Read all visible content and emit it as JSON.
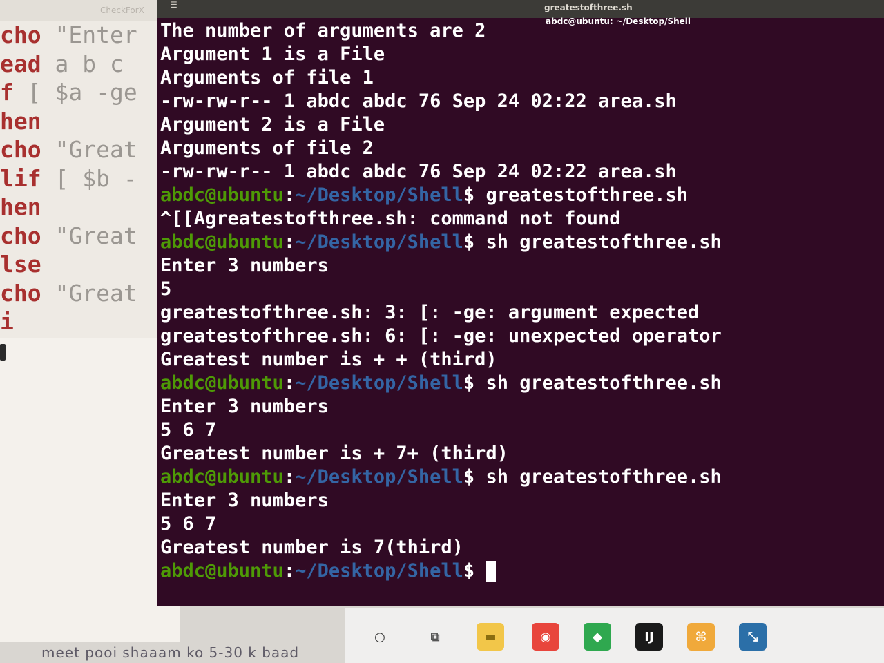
{
  "editor": {
    "tab_title": "CheckForX",
    "lines": [
      {
        "kw": "cho",
        "rest": " \"Enter"
      },
      {
        "kw": "ead",
        "rest": " a b c"
      },
      {
        "kw": "f",
        "rest": " [ $a -ge"
      },
      {
        "kw": "hen",
        "rest": ""
      },
      {
        "kw": "cho",
        "rest": " \"Great"
      },
      {
        "kw": "lif",
        "rest": " [ $b -"
      },
      {
        "kw": "hen",
        "rest": ""
      },
      {
        "kw": "cho",
        "rest": " \"Great"
      },
      {
        "kw": "lse",
        "rest": ""
      },
      {
        "kw": "cho",
        "rest": " \"Great"
      },
      {
        "kw": "i",
        "rest": ""
      }
    ]
  },
  "terminal": {
    "window_title": "greatestofthree.sh",
    "header_path": "abdc@ubuntu: ~/Desktop/Shell",
    "prompt_user": "abdc@ubuntu",
    "prompt_sep": ":",
    "prompt_path": "~/Desktop/Shell",
    "prompt_dollar": "$",
    "lines": [
      {
        "type": "out",
        "text": "The number of arguments are 2"
      },
      {
        "type": "out",
        "text": "Argument 1 is a File"
      },
      {
        "type": "out",
        "text": "Arguments of file 1"
      },
      {
        "type": "out",
        "text": "-rw-rw-r-- 1 abdc abdc 76 Sep 24 02:22 area.sh"
      },
      {
        "type": "out",
        "text": "Argument 2 is a File"
      },
      {
        "type": "out",
        "text": "Arguments of file 2"
      },
      {
        "type": "out",
        "text": "-rw-rw-r-- 1 abdc abdc 76 Sep 24 02:22 area.sh"
      },
      {
        "type": "prompt",
        "cmd": " greatestofthree.sh"
      },
      {
        "type": "out",
        "text": "^[[Agreatestofthree.sh: command not found"
      },
      {
        "type": "prompt",
        "cmd": " sh greatestofthree.sh"
      },
      {
        "type": "out",
        "text": "Enter 3 numbers"
      },
      {
        "type": "out",
        "text": "5"
      },
      {
        "type": "out",
        "text": "greatestofthree.sh: 3: [: -ge: argument expected"
      },
      {
        "type": "out",
        "text": "greatestofthree.sh: 6: [: -ge: unexpected operator"
      },
      {
        "type": "out",
        "text": "Greatest number is + + (third)"
      },
      {
        "type": "prompt",
        "cmd": " sh greatestofthree.sh"
      },
      {
        "type": "out",
        "text": "Enter 3 numbers"
      },
      {
        "type": "out",
        "text": "5 6 7"
      },
      {
        "type": "out",
        "text": "Greatest number is + 7+ (third)"
      },
      {
        "type": "prompt",
        "cmd": " sh greatestofthree.sh"
      },
      {
        "type": "out",
        "text": "Enter 3 numbers"
      },
      {
        "type": "out",
        "text": "5 6 7"
      },
      {
        "type": "out",
        "text": "Greatest number is 7(third)"
      },
      {
        "type": "prompt",
        "cmd": " ",
        "cursor": true
      }
    ]
  },
  "bottom_text": "meet pooi shaaam ko 5-30 k baad",
  "taskbar": {
    "icons": [
      {
        "name": "search-icon",
        "glyph": "○",
        "color": "#f0efee",
        "fg": "#333333"
      },
      {
        "name": "task-view-icon",
        "glyph": "⧉",
        "color": "#f0efee",
        "fg": "#555555"
      },
      {
        "name": "file-explorer-icon",
        "glyph": "▬",
        "color": "#f2c649",
        "fg": "#8a6d10"
      },
      {
        "name": "chrome-icon",
        "glyph": "◉",
        "color": "#e8453c",
        "fg": "#ffffff"
      },
      {
        "name": "maps-icon",
        "glyph": "◆",
        "color": "#2fa84f",
        "fg": "#ffffff"
      },
      {
        "name": "intellij-icon",
        "glyph": "IJ",
        "color": "#1a1a1a",
        "fg": "#ffffff"
      },
      {
        "name": "flow-app-icon",
        "glyph": "⌘",
        "color": "#f0a93b",
        "fg": "#ffffff"
      },
      {
        "name": "remote-app-icon",
        "glyph": "⤡",
        "color": "#2b6fa8",
        "fg": "#ffffff"
      }
    ]
  }
}
